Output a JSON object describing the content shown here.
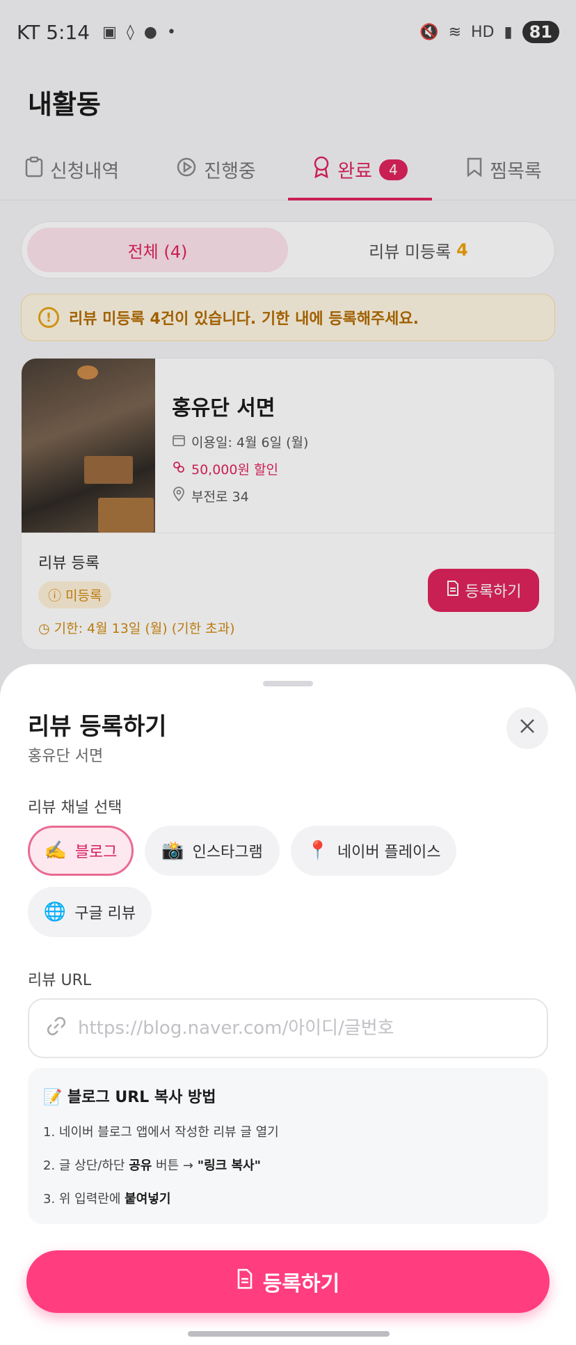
{
  "status": {
    "time": "KT 5:14",
    "battery": "81",
    "hd": "HD"
  },
  "header": {
    "title": "내활동"
  },
  "tabs": [
    {
      "label": "신청내역"
    },
    {
      "label": "진행중"
    },
    {
      "label": "완료",
      "badge": "4"
    },
    {
      "label": "찜목록"
    }
  ],
  "filter": {
    "all": "전체 (4)",
    "unreviewed": "리뷰 미등록",
    "unreviewed_count": "4"
  },
  "notice": {
    "text": "리뷰 미등록 4건이 있습니다. 기한 내에 등록해주세요."
  },
  "card": {
    "name": "홍유단 서면",
    "date": "이용일: 4월 6일 (월)",
    "discount": "50,000원 할인",
    "address": "부전로 34",
    "review_label": "리뷰 등록",
    "status": "미등록",
    "deadline": "기한: 4월 13일 (월) (기한 초과)",
    "register_button": "등록하기"
  },
  "sheet": {
    "title": "리뷰 등록하기",
    "subtitle": "홍유단 서면",
    "channel_label": "리뷰 채널 선택",
    "channels": [
      {
        "emoji": "✍️",
        "label": "블로그"
      },
      {
        "emoji": "📸",
        "label": "인스타그램"
      },
      {
        "emoji": "📍",
        "label": "네이버 플레이스"
      },
      {
        "emoji": "🌐",
        "label": "구글 리뷰"
      }
    ],
    "url_label": "리뷰 URL",
    "url_placeholder": "https://blog.naver.com/아이디/글번호",
    "howto_title": "📝 블로그 URL 복사 방법",
    "step1": "1. 네이버 블로그 앱에서 작성한 리뷰 글 열기",
    "step2_a": "2. 글 상단/하단 ",
    "step2_b": "공유",
    "step2_c": " 버튼 → ",
    "step2_d": "\"링크 복사\"",
    "step3_a": "3. 위 입력란에 ",
    "step3_b": "붙여넣기",
    "submit": "등록하기"
  }
}
